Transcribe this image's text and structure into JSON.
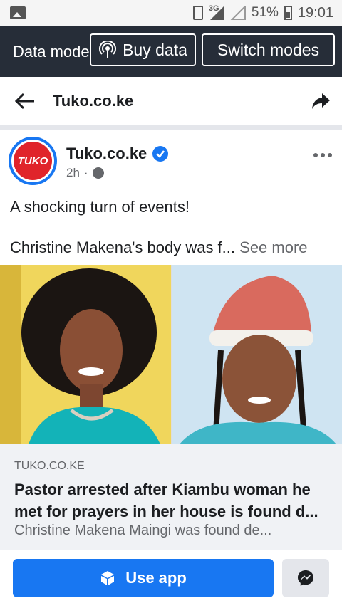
{
  "statusbar": {
    "network": "3G",
    "battery": "51%",
    "time": "19:01",
    "icons": [
      "gallery-icon",
      "vibrate-icon",
      "signal-icon",
      "wifi-icon",
      "battery-icon"
    ]
  },
  "databar": {
    "title": "Data mode",
    "buy_label": "Buy data",
    "switch_label": "Switch modes"
  },
  "header": {
    "title": "Tuko.co.ke"
  },
  "post": {
    "avatar_text": "TUKO",
    "page_name": "Tuko.co.ke",
    "time": "2h",
    "text_line1": "A shocking turn of events!",
    "text_line2": "Christine Makena's body was f...",
    "see_more": "See more"
  },
  "link": {
    "source": "TUKO.CO.KE",
    "title": "Pastor arrested after Kiambu woman he met for prayers in her house is found d...",
    "description": "Christine Makena Maingi was found de..."
  },
  "bottom": {
    "use_app_label": "Use app"
  }
}
